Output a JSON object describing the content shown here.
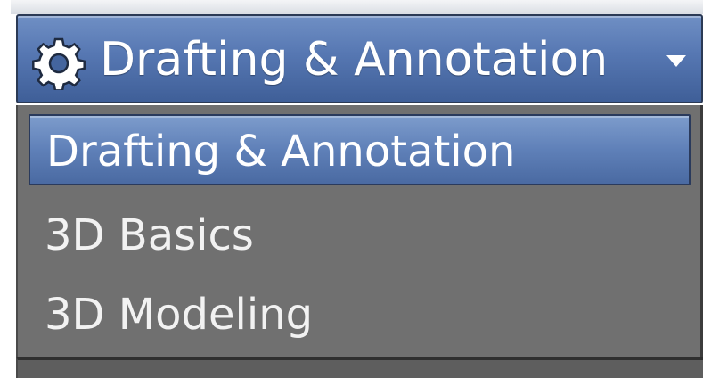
{
  "workspace_selector": {
    "icon": "gear-icon",
    "current_label": "Drafting & Annotation",
    "dropdown_icon": "chevron-down-icon"
  },
  "workspace_menu": {
    "items": [
      {
        "label": "Drafting & Annotation",
        "selected": true
      },
      {
        "label": "3D Basics",
        "selected": false
      },
      {
        "label": "3D Modeling",
        "selected": false
      }
    ]
  },
  "colors": {
    "selector_blue": "#5677b2",
    "menu_gray": "#707070",
    "highlight_blue": "#5f80b8",
    "text": "#ffffff"
  }
}
